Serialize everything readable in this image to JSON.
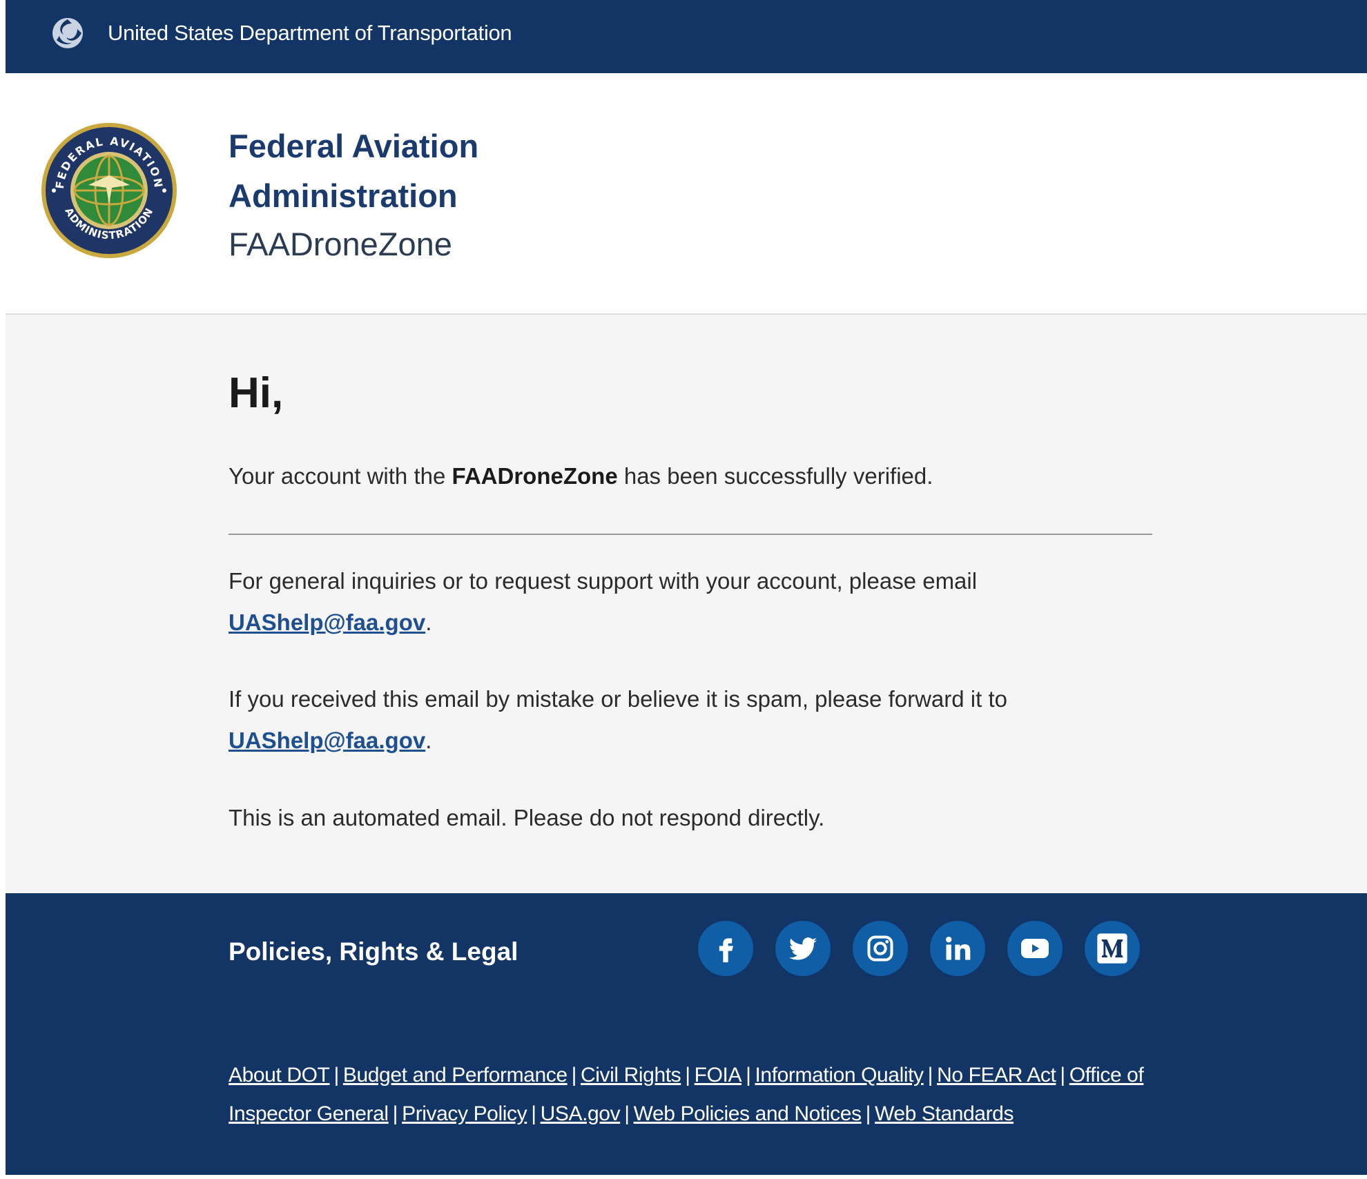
{
  "gov_bar": {
    "title": "United States Department of Transportation",
    "logo_icon": "dot-logo-icon"
  },
  "header": {
    "agency_line1": "Federal Aviation",
    "agency_line2": "Administration",
    "product": "FAADroneZone",
    "seal_text": "FEDERAL AVIATION ADMINISTRATION",
    "seal_icon": "faa-seal-icon"
  },
  "message": {
    "greeting": "Hi,",
    "verified_prefix": "Your account with the ",
    "verified_brand": "FAADroneZone",
    "verified_suffix": " has been successfully verified.",
    "support_text": "For general inquiries or to request support with your account, please email ",
    "support_email": "UAShelp@faa.gov",
    "support_end": ".",
    "spam_text": "If you received this email by mistake or believe it is spam, please forward it to ",
    "spam_email": "UAShelp@faa.gov",
    "spam_end": ".",
    "automated": "This is an automated email. Please do not respond directly."
  },
  "footer": {
    "title": "Policies, Rights & Legal",
    "social": [
      {
        "name": "facebook-icon"
      },
      {
        "name": "twitter-icon"
      },
      {
        "name": "instagram-icon"
      },
      {
        "name": "linkedin-icon"
      },
      {
        "name": "youtube-icon"
      },
      {
        "name": "medium-icon"
      }
    ],
    "links": [
      "About DOT",
      "Budget and Performance",
      "Civil Rights",
      "FOIA",
      "Information Quality",
      "No FEAR Act",
      "Office of Inspector General",
      "Privacy Policy",
      "USA.gov",
      "Web Policies and Notices",
      "Web Standards"
    ],
    "separator": "|"
  },
  "colors": {
    "navy": "#123566",
    "social_blue": "#0f5ea6",
    "link_blue": "#1d4f91",
    "heading_blue": "#1b3b6f"
  }
}
